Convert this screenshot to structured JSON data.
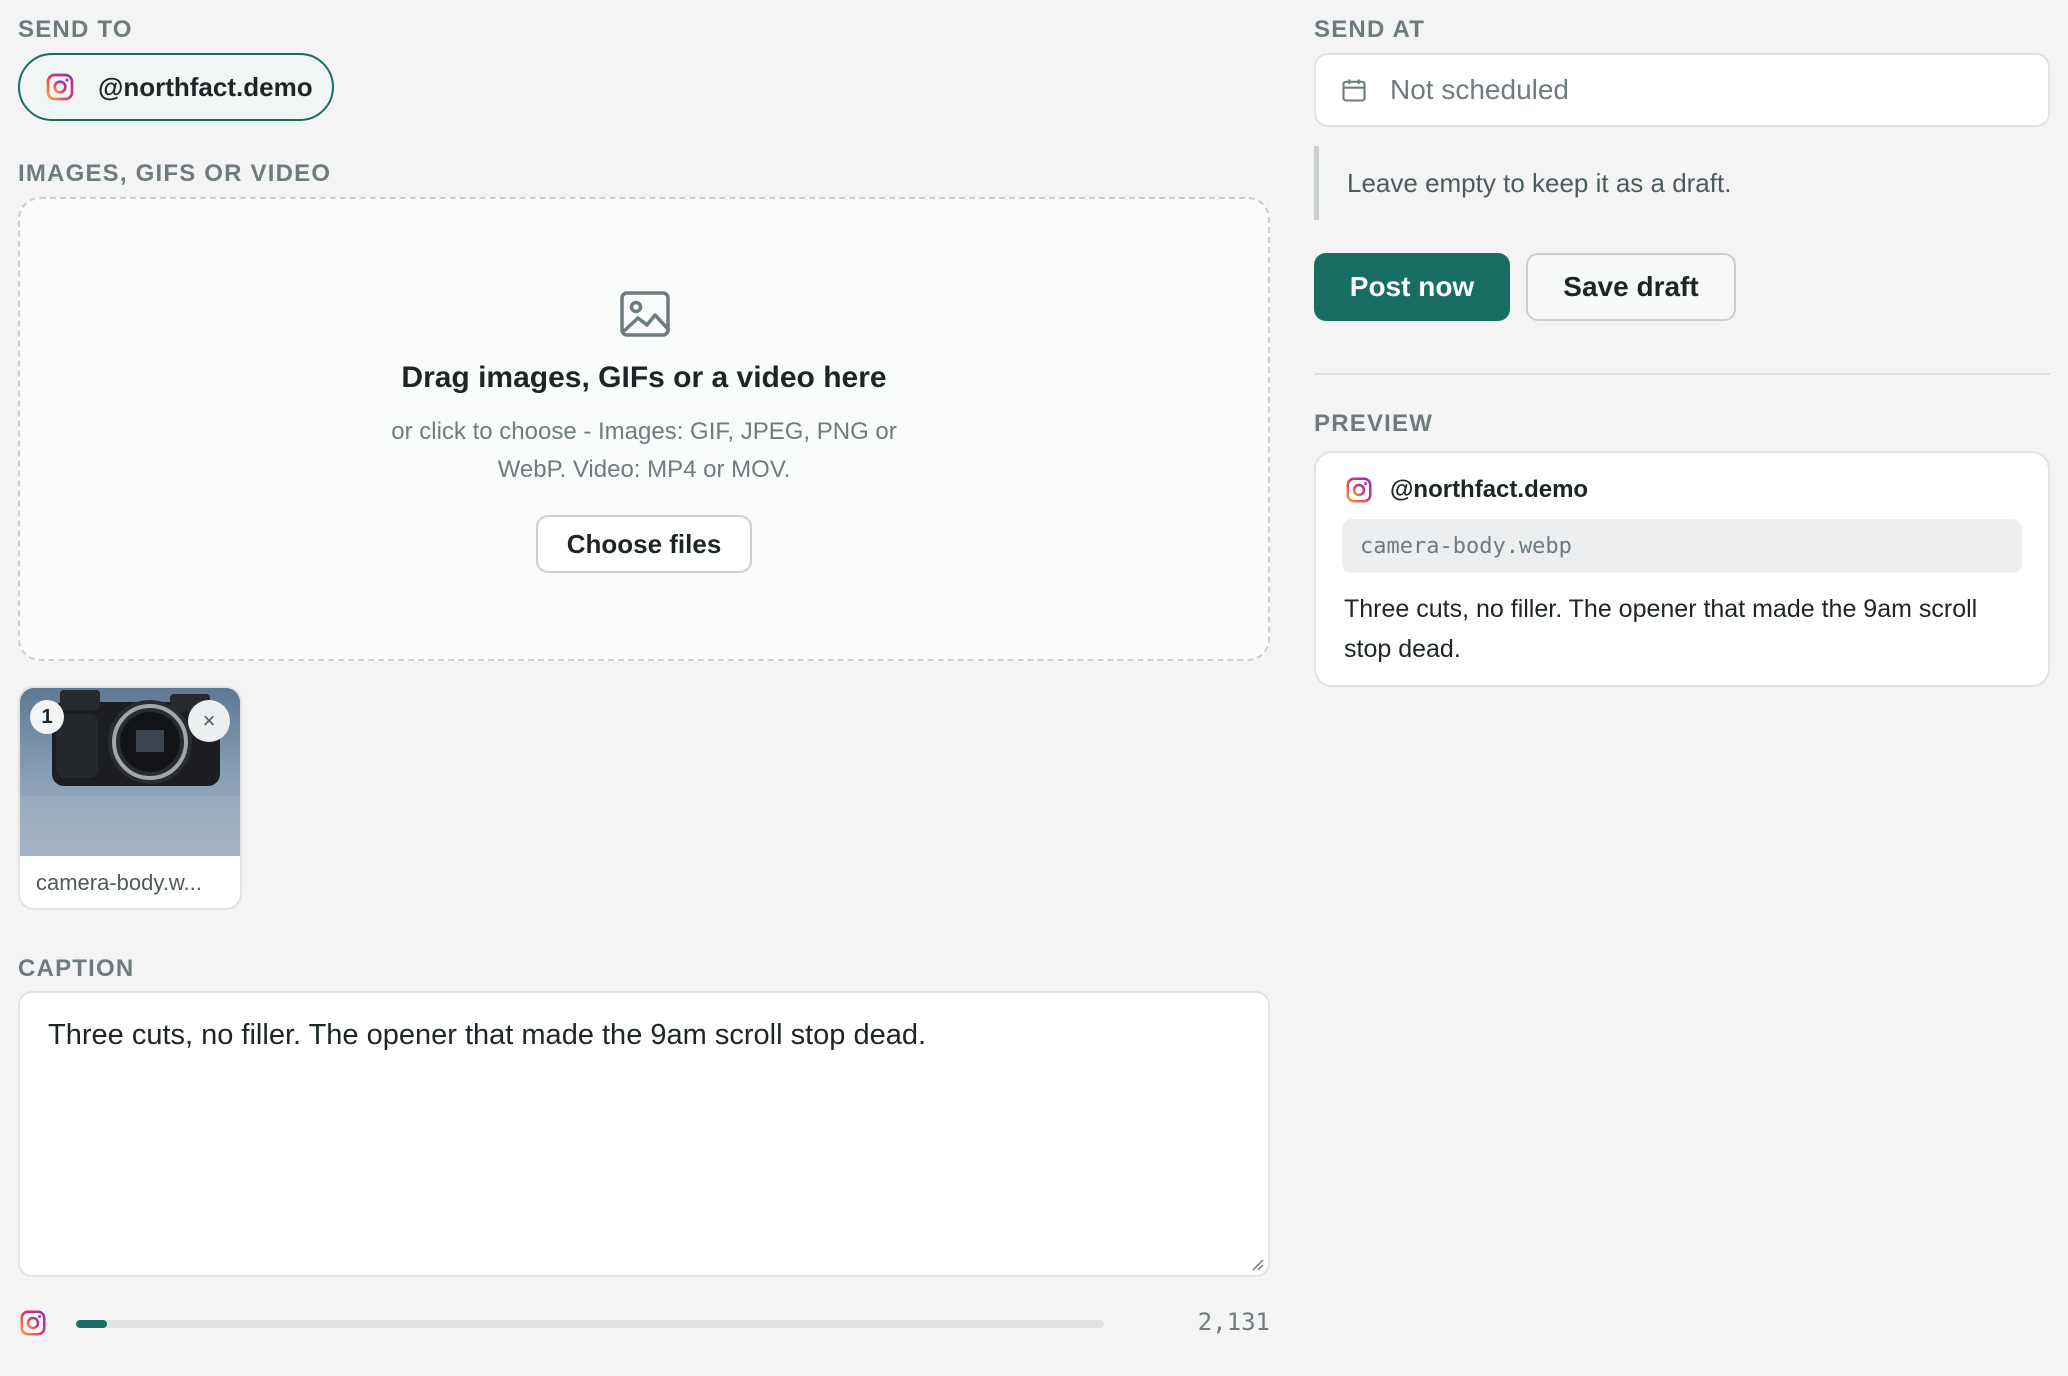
{
  "send_to": {
    "label": "SEND TO",
    "account": "@northfact.demo",
    "account_icon": "instagram-icon"
  },
  "media": {
    "label": "IMAGES, GIFS OR VIDEO",
    "dropzone_title": "Drag images, GIFs or a video here",
    "dropzone_line1": "or click to choose - Images: GIF, JPEG, PNG or",
    "dropzone_line2": "WebP. Video: MP4 or MOV.",
    "choose_button": "Choose files",
    "files": [
      {
        "index": "1",
        "name": "camera-body.w...",
        "remove": "×"
      }
    ]
  },
  "caption": {
    "label": "CAPTION",
    "text": "Three cuts, no filler. The opener that made the 9am scroll stop dead.",
    "progress_fraction": 0.03,
    "remaining": "2,131"
  },
  "schedule": {
    "label": "SEND AT",
    "placeholder": "Not scheduled",
    "hint": "Leave empty to keep it as a draft."
  },
  "actions": {
    "post_now": "Post now",
    "save_draft": "Save draft"
  },
  "preview": {
    "label": "PREVIEW",
    "account": "@northfact.demo",
    "file": "camera-body.webp",
    "caption": "Three cuts, no filler. The opener that made the 9am scroll stop dead."
  },
  "colors": {
    "accent": "#186e63",
    "background": "#f3f4f3"
  }
}
